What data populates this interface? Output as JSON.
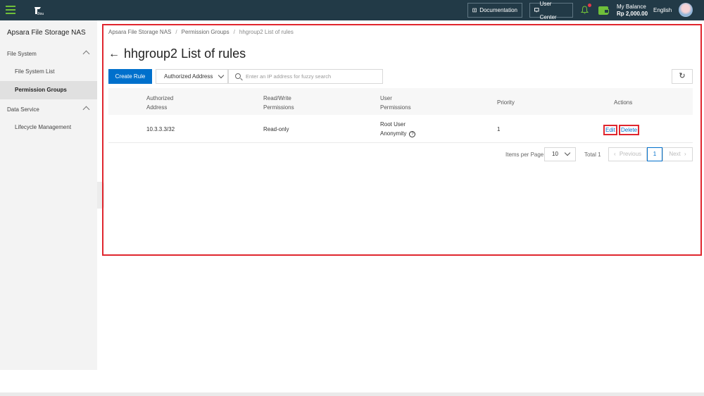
{
  "topbar": {
    "logo_text": "Jiou",
    "documentation_label": "Documentation",
    "user_center_label": "User Center",
    "balance_label": "My Balance",
    "balance_value": "Rp 2,000.00",
    "language": "English"
  },
  "sidebar": {
    "title": "Apsara File Storage NAS",
    "groups": [
      {
        "label": "File System",
        "items": [
          "File System List",
          "Permission Groups"
        ]
      },
      {
        "label": "Data Service",
        "items": [
          "Lifecycle Management"
        ]
      }
    ],
    "active_item": "Permission Groups"
  },
  "breadcrumb": [
    "Apsara File Storage NAS",
    "Permission Groups",
    "hhgroup2 List of rules"
  ],
  "page_title": "hhgroup2 List of rules",
  "toolbar": {
    "create_rule_label": "Create Rule",
    "filter_selected": "Authorized Address",
    "search_placeholder": "Enter an IP address for fuzzy search"
  },
  "table": {
    "columns": [
      [
        "Authorized",
        "Address"
      ],
      [
        "Read/Write",
        "Permissions"
      ],
      [
        "User",
        "Permissions"
      ],
      [
        "Priority"
      ],
      [
        "Actions"
      ]
    ],
    "rows": [
      {
        "address": "10.3.3.3/32",
        "rw": "Read-only",
        "user_perm_line1": "Root User",
        "user_perm_line2": "Anonymity",
        "priority": "1",
        "actions": [
          "Edit",
          "Delete"
        ]
      }
    ]
  },
  "pagination": {
    "items_per_page_label": "Items per Page",
    "items_per_page": "10",
    "total_label": "Total 1",
    "previous_label": "Previous",
    "current_page": "1",
    "next_label": "Next"
  },
  "colors": {
    "topbar": "#223a47",
    "accent": "#0070cc",
    "highlight": "#e0262e",
    "brand_green": "#6fbf3a"
  },
  "icons": [
    "menu-icon",
    "document-icon",
    "monitor-icon",
    "bell-icon",
    "wallet-icon",
    "back-arrow-icon",
    "search-icon",
    "refresh-icon",
    "help-icon",
    "chevron-down-icon",
    "chevron-left-icon",
    "chevron-right-icon",
    "chevron-up-icon"
  ]
}
